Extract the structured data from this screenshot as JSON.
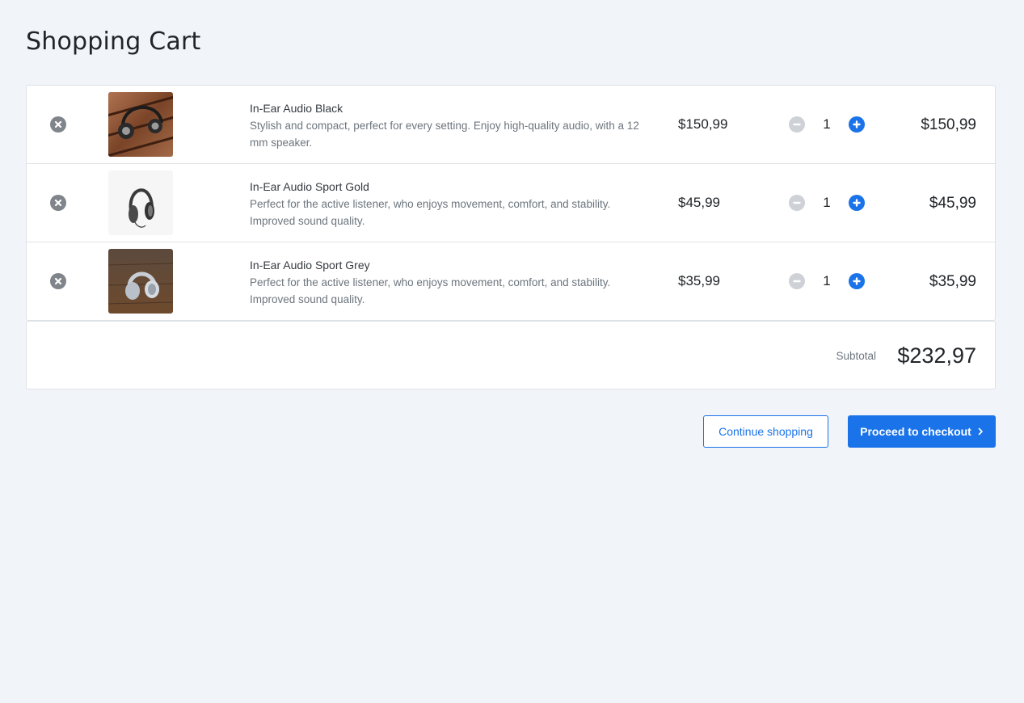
{
  "page": {
    "title": "Shopping Cart"
  },
  "colors": {
    "accent": "#1a73e8",
    "background": "#f1f4f8",
    "muted_icon": "#80858b",
    "disabled_icon": "#ced2d7"
  },
  "cart": {
    "items": [
      {
        "name": "In-Ear Audio Black",
        "description": "Stylish and compact, perfect for every setting. Enjoy high-quality audio, with a 12 mm speaker.",
        "price": "$150,99",
        "quantity": "1",
        "total": "$150,99",
        "image_icon": "headphones-black-on-wood"
      },
      {
        "name": "In-Ear Audio Sport Gold",
        "description": "Perfect for the active listener, who enjoys movement, comfort, and stability. Improved sound quality.",
        "price": "$45,99",
        "quantity": "1",
        "total": "$45,99",
        "image_icon": "headphones-grey-on-white"
      },
      {
        "name": "In-Ear Audio Sport Grey",
        "description": "Perfect for the active listener, who enjoys movement, comfort, and stability. Improved sound quality.",
        "price": "$35,99",
        "quantity": "1",
        "total": "$35,99",
        "image_icon": "headphones-white-on-floor"
      }
    ]
  },
  "summary": {
    "subtotal_label": "Subtotal",
    "subtotal_value": "$232,97"
  },
  "actions": {
    "continue_label": "Continue shopping",
    "checkout_label": "Proceed to checkout"
  }
}
